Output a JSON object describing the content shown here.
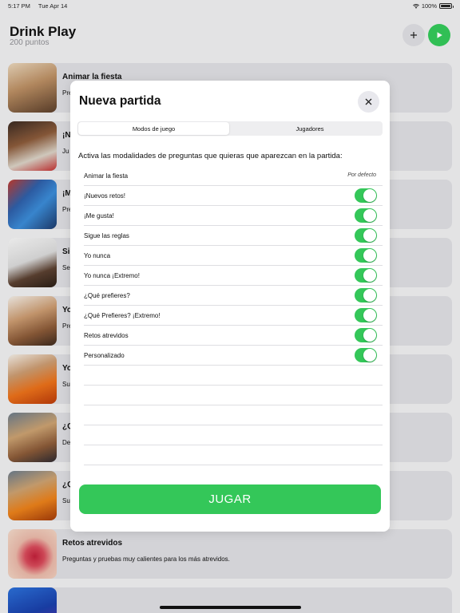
{
  "status": {
    "time": "5:17 PM",
    "date": "Tue Apr 14",
    "battery": "100%"
  },
  "header": {
    "title": "Drink Play",
    "points": "200 puntos"
  },
  "cards": [
    {
      "title": "Animar la fiesta",
      "desc": "Pre"
    },
    {
      "title": "¡N",
      "desc": "Ju"
    },
    {
      "title": "¡M",
      "desc": "Pre"
    },
    {
      "title": "Sig",
      "desc": "Se"
    },
    {
      "title": "Yo",
      "desc": "Pre"
    },
    {
      "title": "Yo",
      "desc": "Su"
    },
    {
      "title": "¿Q",
      "desc": "De"
    },
    {
      "title": "¿Q",
      "desc": "Su"
    },
    {
      "title": "Retos atrevidos",
      "desc": "Preguntas y pruebas muy calientes para los más atrevidos."
    },
    {
      "title": "",
      "desc": ""
    }
  ],
  "modal": {
    "title": "Nueva partida",
    "tabs": [
      "Modos de juego",
      "Jugadores"
    ],
    "instructions": "Activa las modalidades de preguntas que quieras que aparezcan en la partida:",
    "default_mode": {
      "label": "Animar la fiesta",
      "badge": "Por defecto"
    },
    "modes": [
      {
        "label": "¡Nuevos retos!",
        "enabled": true
      },
      {
        "label": "¡Me gusta!",
        "enabled": true
      },
      {
        "label": "Sigue las reglas",
        "enabled": true
      },
      {
        "label": "Yo nunca",
        "enabled": true
      },
      {
        "label": "Yo nunca ¡Extremo!",
        "enabled": true
      },
      {
        "label": "¿Qué prefieres?",
        "enabled": true
      },
      {
        "label": "¿Qué Prefieres? ¡Extremo!",
        "enabled": true
      },
      {
        "label": "Retos atrevidos",
        "enabled": true
      },
      {
        "label": "Personalizado",
        "enabled": true
      }
    ],
    "play_label": "JUGAR"
  },
  "colors": {
    "accent_green": "#34c759",
    "background": "#ededee",
    "card": "#dcdce0"
  }
}
